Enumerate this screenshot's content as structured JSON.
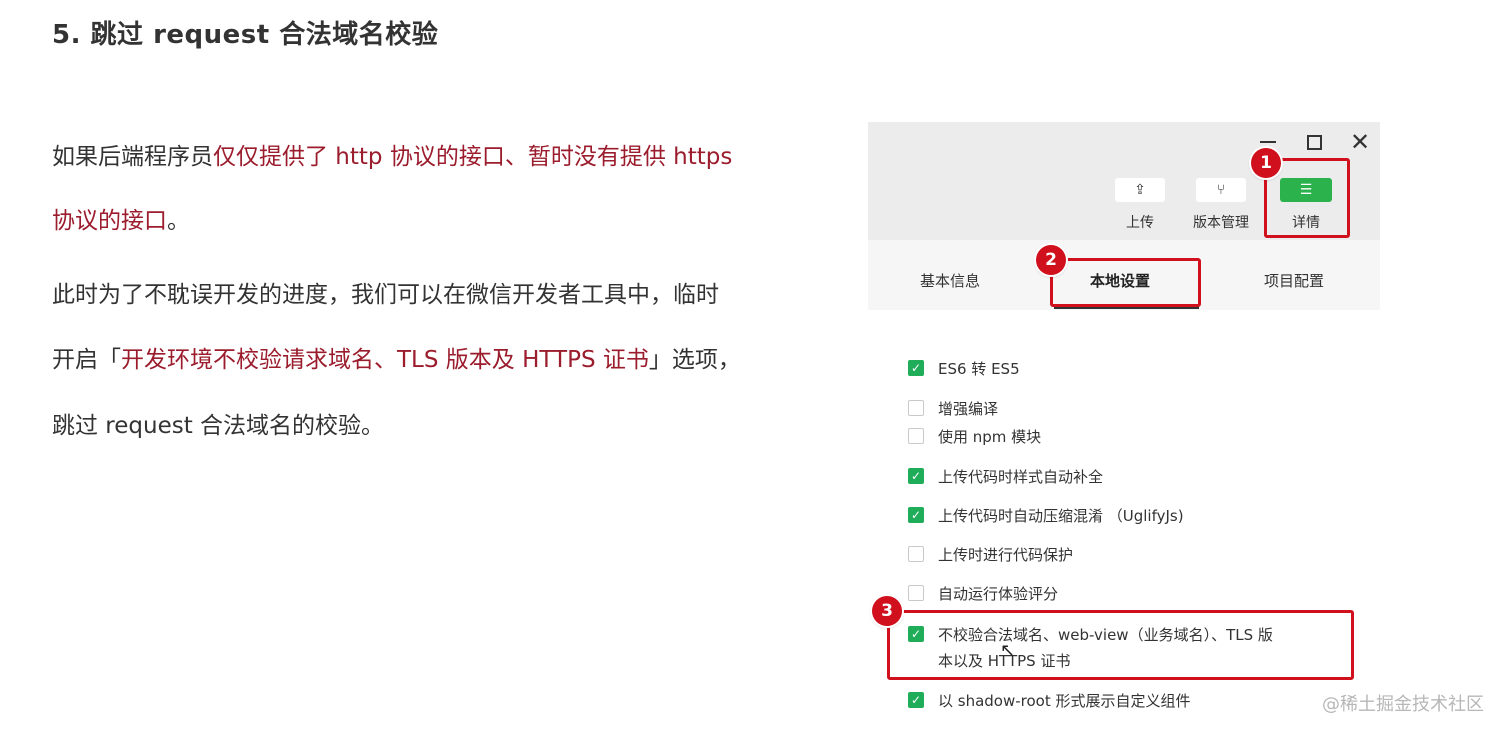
{
  "slide": {
    "title": "5. 跳过 request 合法域名校验",
    "p1": {
      "prefix": "如果后端程序员",
      "highlight1": "仅仅提供了 http 协议的接口、暂时没有提供 https",
      "line2": "协议的接口",
      "suffix": "。"
    },
    "p2": {
      "line1": "此时为了不耽误开发的进度，我们可以在微信开发者工具中，临时",
      "line2_prefix": "开启「",
      "line2_highlight": "开发环境不校验请求域名、TLS 版本及 HTTPS 证书",
      "line2_suffix": "」选项，",
      "line3": "跳过 request 合法域名的校验。"
    }
  },
  "devtool": {
    "toolbar": {
      "upload_label": "上传",
      "version_label": "版本管理",
      "detail_label": "详情"
    },
    "tabs": {
      "basic": "基本信息",
      "local": "本地设置",
      "project": "项目配置"
    },
    "options": [
      {
        "label": "ES6 转 ES5",
        "checked": true
      },
      {
        "label": "增强编译",
        "checked": false
      },
      {
        "label": "使用 npm 模块",
        "checked": false
      },
      {
        "label": "上传代码时样式自动补全",
        "checked": true
      },
      {
        "label": "上传代码时自动压缩混淆 （UglifyJs)",
        "checked": true
      },
      {
        "label": "上传时进行代码保护",
        "checked": false
      },
      {
        "label": "自动运行体验评分",
        "checked": false
      },
      {
        "label": "不校验合法域名、web-view（业务域名）、TLS 版",
        "label_line2": "本以及 HTTPS 证书",
        "checked": true
      },
      {
        "label": "以 shadow-root 形式展示自定义组件",
        "checked": true
      }
    ],
    "annotations": {
      "b1": "1",
      "b2": "2",
      "b3": "3"
    }
  },
  "watermark": "@稀土掘金技术社区",
  "colors": {
    "highlight": "#9b1c2c",
    "annotation_red": "#d0101c",
    "check_green": "#1fad5a",
    "detail_green": "#2bb24c"
  }
}
